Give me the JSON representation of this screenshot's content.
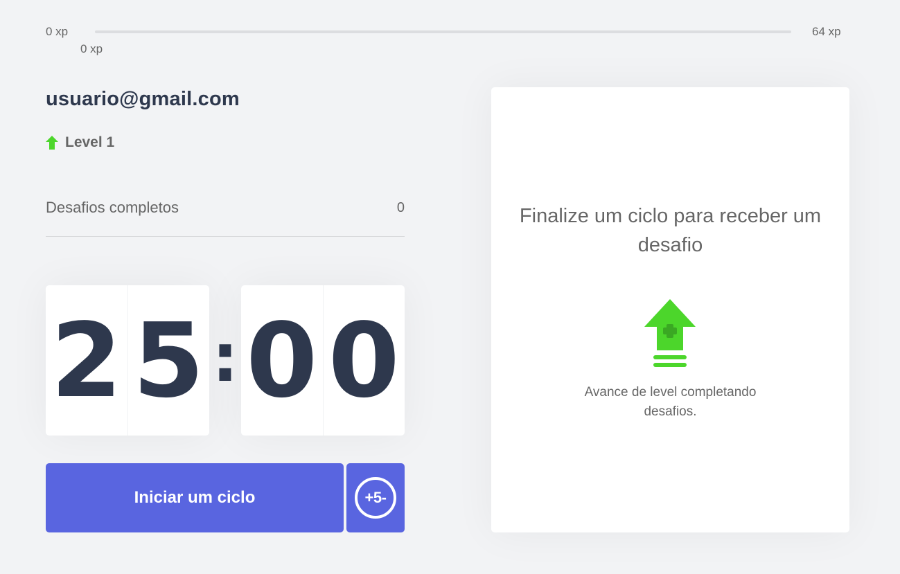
{
  "experience": {
    "min_label": "0 xp",
    "max_label": "64 xp",
    "current_label": "0 xp",
    "progress_fraction": 0,
    "bar_color": "#4cd62b"
  },
  "profile": {
    "email": "usuario@gmail.com",
    "level_icon": "level-up-arrow-icon",
    "level_label": "Level 1"
  },
  "completed_challenges": {
    "label": "Desafios completos",
    "count": "0"
  },
  "countdown": {
    "minute_left": "2",
    "minute_right": "5",
    "separator": ":",
    "second_left": "0",
    "second_right": "0"
  },
  "buttons": {
    "start_label": "Iniciar um ciclo",
    "plus5_label": "+5-"
  },
  "challenge_box": {
    "title": "Finalize um ciclo para receber um desafio",
    "icon": "level-up-icon",
    "description": "Avance de level completando desafios."
  },
  "colors": {
    "background": "#f2f3f5",
    "primary": "#5965e0",
    "green": "#4cd62b",
    "title": "#2e384d",
    "text": "#666666"
  }
}
